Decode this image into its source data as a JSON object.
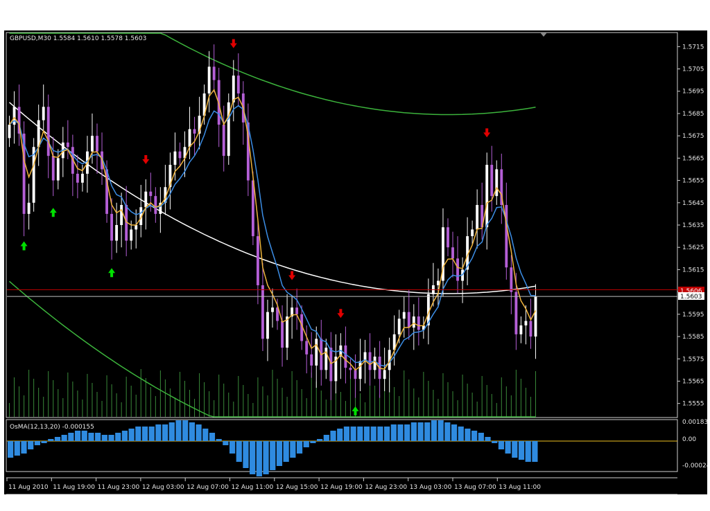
{
  "window": {
    "symbol_info": "GBPUSD,M30  1.5584  1.5610  1.5578  1.5603",
    "indicator_label": "OsMA(12,13,20)  -0.000155",
    "current_price_label": "1.5603",
    "alert_price_label": "1.5606"
  },
  "colors": {
    "background": "#000000",
    "bull_candle": "#ffffff",
    "bear_candle": "#b45fd6",
    "ema_fast": "#f0b43c",
    "ema_slow": "#3c8ee6",
    "regression_mid": "#ffffff",
    "regression_band": "#3cb43c",
    "up_arrow": "#00e000",
    "down_arrow": "#e00000",
    "osma_bar": "#2f8be0",
    "zero_line": "#f0c020",
    "volume": "#3a8a3a"
  },
  "chart_data": [
    {
      "type": "candlestick",
      "title": "GBPUSD,M30",
      "ylim": [
        1.5549,
        1.5721
      ],
      "y_ticks": [
        "1.5715",
        "1.5705",
        "1.5695",
        "1.5685",
        "1.5675",
        "1.5665",
        "1.5655",
        "1.5645",
        "1.5635",
        "1.5625",
        "1.5615",
        "1.5605",
        "1.5595",
        "1.5585",
        "1.5575",
        "1.5565",
        "1.5555"
      ],
      "x_ticks": [
        "11 Aug 2010",
        "11 Aug 19:00",
        "11 Aug 23:00",
        "12 Aug 03:00",
        "12 Aug 07:00",
        "12 Aug 11:00",
        "12 Aug 15:00",
        "12 Aug 19:00",
        "12 Aug 23:00",
        "13 Aug 03:00",
        "13 Aug 07:00",
        "13 Aug 11:00"
      ],
      "close": [
        1.568,
        1.5688,
        1.5676,
        1.564,
        1.5645,
        1.567,
        1.5682,
        1.5688,
        1.5666,
        1.5655,
        1.5665,
        1.5672,
        1.567,
        1.5658,
        1.5654,
        1.5658,
        1.5668,
        1.5675,
        1.5668,
        1.566,
        1.564,
        1.5628,
        1.5635,
        1.5644,
        1.5628,
        1.5633,
        1.5635,
        1.5643,
        1.565,
        1.5648,
        1.564,
        1.5645,
        1.5652,
        1.5662,
        1.5668,
        1.5665,
        1.567,
        1.5678,
        1.5676,
        1.5684,
        1.5694,
        1.5706,
        1.57,
        1.568,
        1.5666,
        1.569,
        1.5702,
        1.5694,
        1.5681,
        1.5655,
        1.563,
        1.5608,
        1.5584,
        1.5596,
        1.5598,
        1.5592,
        1.558,
        1.5594,
        1.5598,
        1.5595,
        1.5583,
        1.5577,
        1.5572,
        1.5584,
        1.557,
        1.558,
        1.5565,
        1.5576,
        1.5581,
        1.5571,
        1.557,
        1.5566,
        1.5574,
        1.5578,
        1.557,
        1.5576,
        1.5566,
        1.557,
        1.5579,
        1.5586,
        1.5593,
        1.5596,
        1.5589,
        1.5594,
        1.5588,
        1.559,
        1.5604,
        1.5608,
        1.561,
        1.5634,
        1.5625,
        1.562,
        1.561,
        1.5615,
        1.563,
        1.5633,
        1.5644,
        1.5634,
        1.5662,
        1.5648,
        1.566,
        1.5644,
        1.5616,
        1.5605,
        1.5586,
        1.559,
        1.5592,
        1.5585,
        1.5603
      ]
    },
    {
      "type": "bar",
      "title": "OsMA(12,13,20)",
      "y_ticks": [
        "0.00183",
        "0.00",
        "-0.00024"
      ],
      "values": [
        -0.0008,
        -0.0007,
        -0.0006,
        -0.0004,
        -0.0002,
        -0.0001,
        0.0001,
        0.0002,
        0.0003,
        0.0004,
        0.0005,
        0.0005,
        0.0004,
        0.0004,
        0.0003,
        0.0003,
        0.0004,
        0.0005,
        0.0006,
        0.0007,
        0.0007,
        0.0007,
        0.0008,
        0.0008,
        0.0009,
        0.001,
        0.001,
        0.0009,
        0.0008,
        0.0006,
        0.0004,
        0.0001,
        -0.0002,
        -0.0006,
        -0.001,
        -0.0013,
        -0.0016,
        -0.0017,
        -0.0016,
        -0.0014,
        -0.0012,
        -0.001,
        -0.0008,
        -0.0006,
        -0.0003,
        -0.0001,
        0.0001,
        0.0003,
        0.0005,
        0.0006,
        0.0007,
        0.0007,
        0.0007,
        0.0007,
        0.0007,
        0.0007,
        0.0007,
        0.0008,
        0.0008,
        0.0008,
        0.0009,
        0.0009,
        0.0009,
        0.001,
        0.001,
        0.0009,
        0.0008,
        0.0007,
        0.0006,
        0.0005,
        0.0004,
        0.0002,
        -0.0001,
        -0.0004,
        -0.0006,
        -0.0008,
        -0.0009,
        -0.001,
        -0.001
      ]
    }
  ]
}
